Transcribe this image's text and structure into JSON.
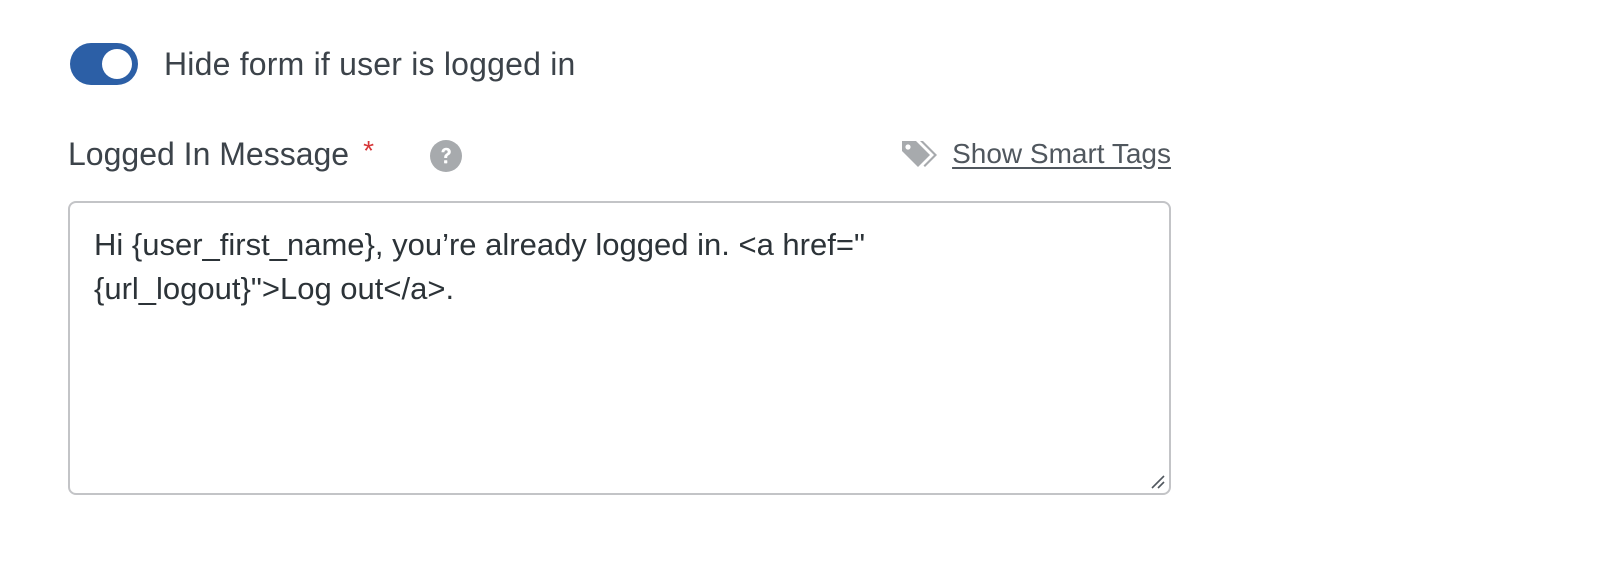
{
  "colors": {
    "accent": "#2c5fa6",
    "required": "#d63638",
    "icon_gray": "#a7aaad",
    "text": "#3c434a"
  },
  "toggle": {
    "label": "Hide form if user is logged in",
    "state": "on",
    "icon": "toggle-switch"
  },
  "field": {
    "label": "Logged In Message",
    "required_mark": "*",
    "help_icon": "question-circle-icon",
    "smart_tags": {
      "icon": "tags-icon",
      "label": "Show Smart Tags"
    },
    "value": "Hi {user_first_name}, you’re already logged in. <a href=\"\n{url_logout}\">Log out</a>."
  }
}
